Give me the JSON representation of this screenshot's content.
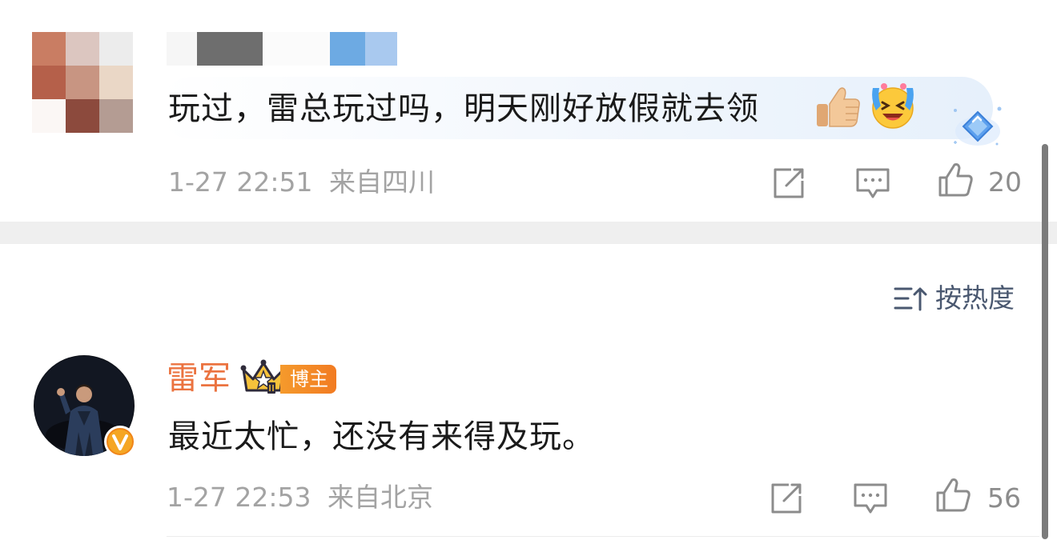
{
  "comments": [
    {
      "text": "玩过，雷总玩过吗，明天刚好放假就去领",
      "emojis": [
        "thumbs-up",
        "laughing-crying"
      ],
      "time": "1-27 22:51",
      "location": "来自四川",
      "likes": "20"
    },
    {
      "author": "雷军",
      "badge": "博主",
      "text": "最近太忙，还没有来得及玩。",
      "time": "1-27 22:53",
      "location": "来自北京",
      "likes": "56"
    }
  ],
  "sort": {
    "label": "按热度",
    "icon": "sort-icon"
  },
  "colors": {
    "author_name": "#eb7340",
    "meta_text": "#a3a3a3",
    "body_text": "#1a1a1a",
    "sort_text": "#4a5870",
    "separator": "#efefef",
    "badge": "#f27b22"
  }
}
